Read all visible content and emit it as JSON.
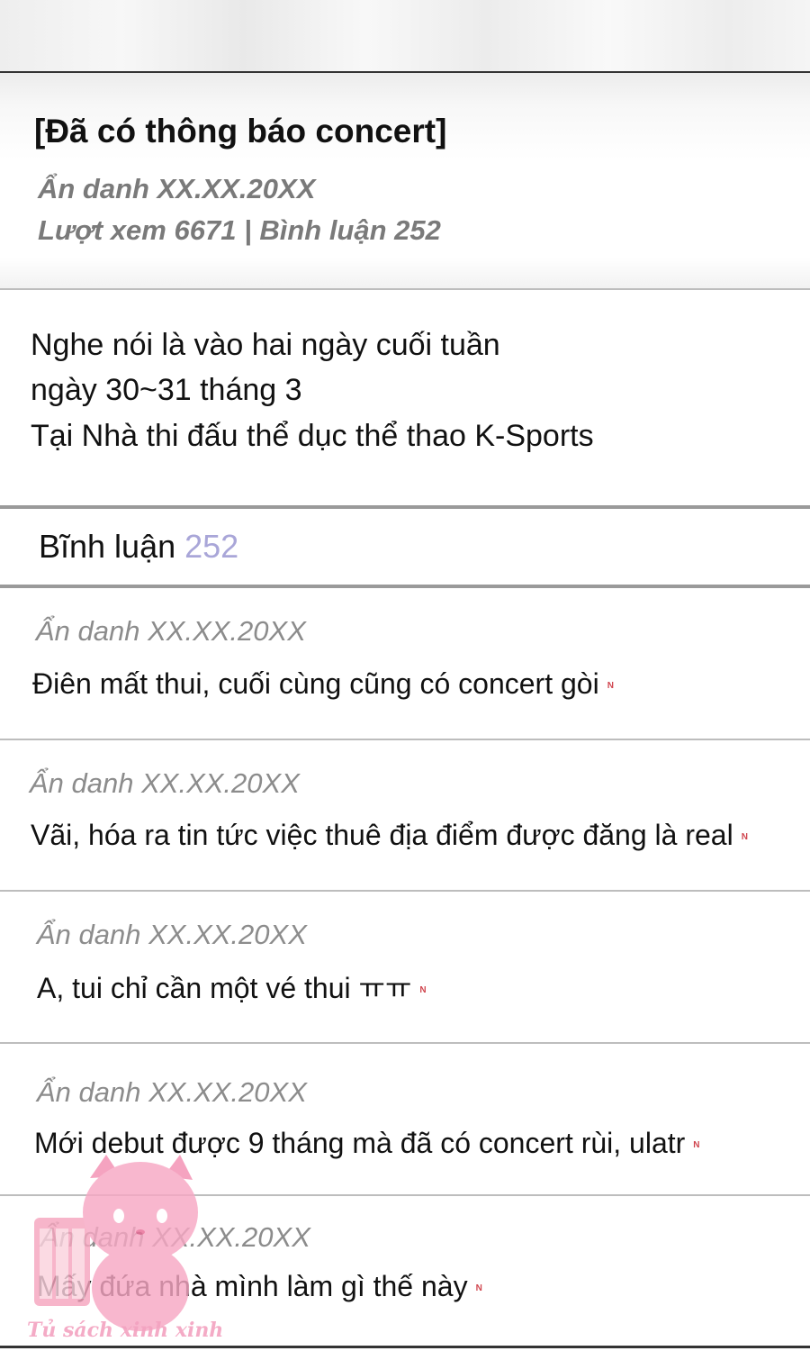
{
  "post": {
    "title": "[Đã có thông báo concert]",
    "author_date": "Ẩn danh XX.XX.20XX",
    "stats": "Lượt xem 6671 | Bình luận 252",
    "body": [
      "Nghe nói là vào hai ngày cuối tuần",
      "ngày 30~31 tháng 3",
      "Tại Nhà thi đấu thể dục thể thao K-Sports"
    ]
  },
  "comments_section": {
    "label": "Bĩnh luận",
    "count": "252",
    "count_color": "#a9a6d8"
  },
  "comments": [
    {
      "author": "Ẩn danh XX.XX.20XX",
      "text": "Điên mất thui, cuối cùng cũng có concert gòi"
    },
    {
      "author": "Ẩn danh XX.XX.20XX",
      "text": "Vãi, hóa ra tin tức việc thuê địa điểm được đăng là real"
    },
    {
      "author": "Ẩn danh XX.XX.20XX",
      "text": "A, tui chỉ cần một vé thui ㅠㅠ"
    },
    {
      "author": "Ẩn danh XX.XX.20XX",
      "text": "Mới debut được 9 tháng mà đã có concert rùi, ulatr"
    },
    {
      "author": "Ẩn danh XX.XX.20XX",
      "text": "Mấy đứa nhà mình làm gì thế này"
    }
  ],
  "new_badge": "N",
  "watermark": {
    "text": "Tủ sách xinh xinh",
    "icon": "pink-cat-icon",
    "color": "#f3a3c0"
  }
}
